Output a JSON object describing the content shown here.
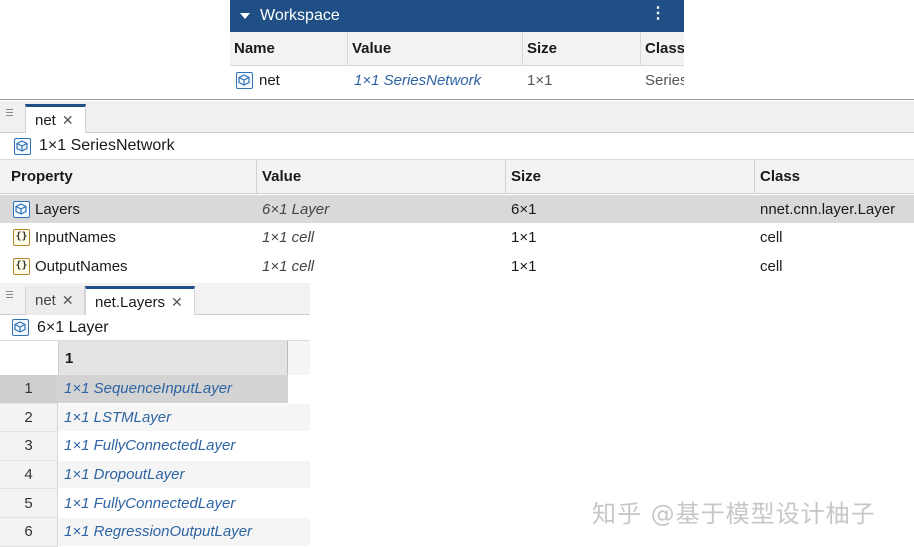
{
  "workspace": {
    "title": "Workspace",
    "menu_icon": "kebab-menu-icon",
    "columns": [
      "Name",
      "Value",
      "Size",
      "Class"
    ],
    "row": {
      "icon": "object-cube-icon",
      "name": "net",
      "value": "1×1 SeriesNetwork",
      "size": "1×1",
      "class": "Series"
    }
  },
  "net_editor": {
    "tab_label": "net",
    "close_glyph": "✕",
    "subtitle": "1×1 SeriesNetwork",
    "columns": [
      "Property",
      "Value",
      "Size",
      "Class"
    ],
    "rows": [
      {
        "icon": "object-cube-icon",
        "property": "Layers",
        "value": "6×1 Layer",
        "size": "6×1",
        "class": "nnet.cnn.layer.Layer",
        "selected": true
      },
      {
        "icon": "cell-brace-icon",
        "property": "InputNames",
        "value": "1×1 cell",
        "size": "1×1",
        "class": "cell",
        "selected": false
      },
      {
        "icon": "cell-brace-icon",
        "property": "OutputNames",
        "value": "1×1 cell",
        "size": "1×1",
        "class": "cell",
        "selected": false
      }
    ]
  },
  "layers_editor": {
    "tabs": [
      {
        "label": "net",
        "active": false
      },
      {
        "label": "net.Layers",
        "active": true
      }
    ],
    "close_glyph": "✕",
    "subtitle": "6×1 Layer",
    "column_header": "1",
    "rows": [
      {
        "index": "1",
        "value": "1×1 SequenceInputLayer"
      },
      {
        "index": "2",
        "value": "1×1 LSTMLayer"
      },
      {
        "index": "3",
        "value": "1×1 FullyConnectedLayer"
      },
      {
        "index": "4",
        "value": "1×1 DropoutLayer"
      },
      {
        "index": "5",
        "value": "1×1 FullyConnectedLayer"
      },
      {
        "index": "6",
        "value": "1×1 RegressionOutputLayer"
      }
    ]
  },
  "watermark": "知乎 @基于模型设计柚子",
  "colors": {
    "title_bar": "#1f4f84",
    "link_text": "#2e64a3",
    "selection": "#d9d9d9"
  }
}
